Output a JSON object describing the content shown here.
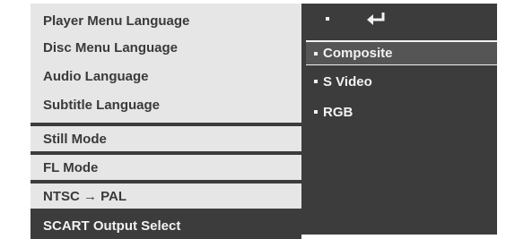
{
  "menu": {
    "left_items": [
      {
        "label": "Player Menu Language"
      },
      {
        "label": "Disc Menu Language"
      },
      {
        "label": "Audio Language"
      },
      {
        "label": "Subtitle Language"
      },
      {
        "label": "Still Mode"
      },
      {
        "label": "FL Mode"
      },
      {
        "label": "NTSC → PAL"
      },
      {
        "label": "SCART Output Select"
      }
    ],
    "selected_item": "SCART Output Select",
    "return_icon": "return-arrow-icon",
    "options": [
      {
        "label": "Composite",
        "state": "highlighted"
      },
      {
        "label": "S Video",
        "state": "normal"
      },
      {
        "label": "RGB",
        "state": "normal"
      }
    ]
  },
  "colors": {
    "panel_dark": "#3c3c3c",
    "panel_light": "#e6e6e6",
    "highlight": "#555555",
    "text_dark": "#3a3a3a",
    "text_light": "#f2f2f2"
  }
}
